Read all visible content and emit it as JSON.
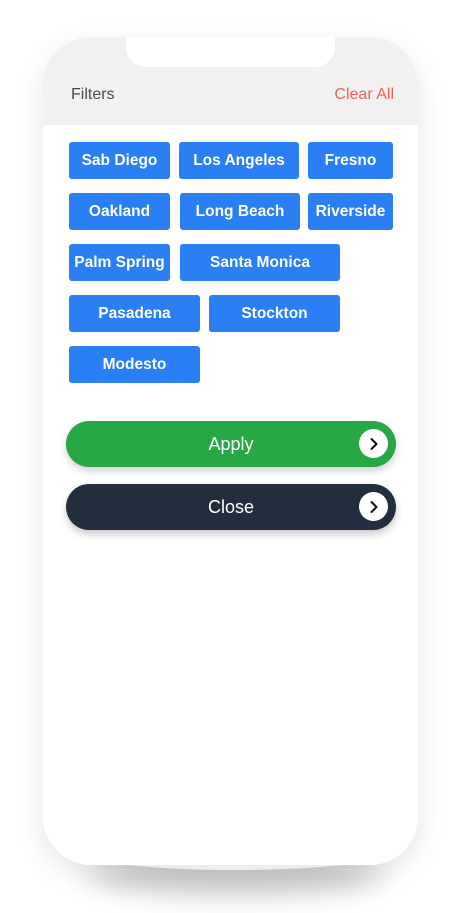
{
  "header": {
    "title": "Filters",
    "clear_all_label": "Clear All"
  },
  "chips": [
    {
      "label": "Sab Diego"
    },
    {
      "label": "Los Angeles"
    },
    {
      "label": "Fresno"
    },
    {
      "label": "Oakland"
    },
    {
      "label": "Long Beach"
    },
    {
      "label": "Riverside"
    },
    {
      "label": "Palm Spring"
    },
    {
      "label": "Santa Monica"
    },
    {
      "label": "Pasadena"
    },
    {
      "label": "Stockton"
    },
    {
      "label": "Modesto"
    }
  ],
  "actions": {
    "apply_label": "Apply",
    "close_label": "Close"
  },
  "icons": {
    "apply_arrow": "chevron-right-icon",
    "close_arrow": "chevron-right-icon"
  },
  "colors": {
    "chip": "#2a7ff4",
    "apply": "#28a745",
    "close": "#222d3e",
    "clear_all": "#f0605d",
    "header_bg": "#f1f1f1"
  }
}
